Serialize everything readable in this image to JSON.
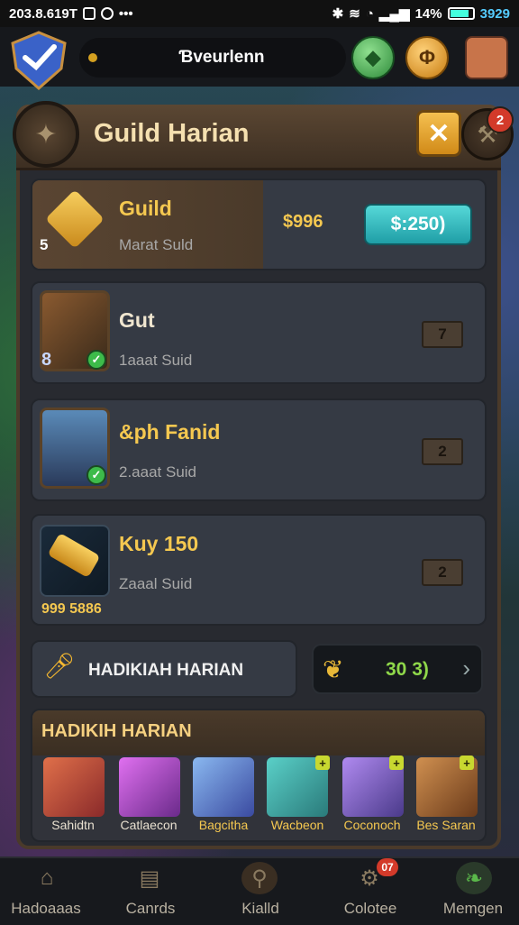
{
  "status_bar": {
    "left_text": "203.8.619T",
    "right_percent": "14%",
    "time": "3929"
  },
  "top_bar": {
    "name": "Ɓveurlenn",
    "icons": [
      "shield-icon",
      "gem-icon",
      "coin-icon",
      "avatar"
    ]
  },
  "header": {
    "title": "Guild Harian",
    "close_label": "✕",
    "tools_badge": "2"
  },
  "rows": [
    {
      "title": "Guild",
      "subtitle": "Marat Suld",
      "badge": "5",
      "price": "$996",
      "button": "$:250)"
    },
    {
      "title": "Gut",
      "subtitle": "1aaat Suid",
      "badge": "8",
      "lock": "7"
    },
    {
      "title": "&ph Fanid",
      "subtitle": "2.aaat Suid",
      "lock": "2"
    },
    {
      "title": "Kuy 150",
      "subtitle": "Zaaal Suid",
      "badge": "999 5886",
      "lock": "2"
    }
  ],
  "reward": {
    "label": "HADIKIAH HARIAN",
    "value": "30 3)",
    "arrow": "›"
  },
  "section": {
    "title": "HADIKIH HARIAN",
    "items": [
      {
        "label": "Sahidtn",
        "color": "#d9574a"
      },
      {
        "label": "Catlaecon",
        "color": "#c94ad0"
      },
      {
        "label": "Bagcitha",
        "color": "#5a8ad8"
      },
      {
        "label": "Wacbeon",
        "color": "#e8b030"
      },
      {
        "label": "Coconoch",
        "color": "#8a5ad0"
      },
      {
        "label": "Bes Saran",
        "color": "#b06a30"
      }
    ]
  },
  "nav": [
    {
      "label": "Hadoaaas",
      "icon": "house-icon"
    },
    {
      "label": "Canrds",
      "icon": "cards-icon"
    },
    {
      "label": "Kialld",
      "icon": "emblem-icon"
    },
    {
      "label": "Colotee",
      "icon": "gear-icon",
      "badge": "07"
    },
    {
      "label": "Memgen",
      "icon": "leaf-icon"
    }
  ]
}
